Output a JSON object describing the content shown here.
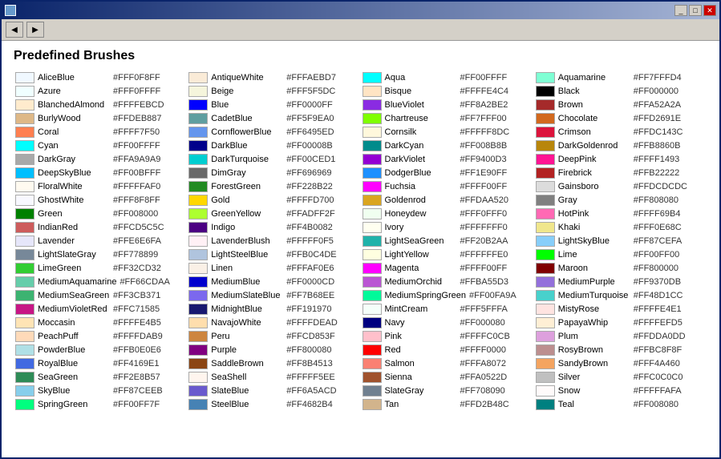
{
  "window": {
    "title": "",
    "toolbar": {
      "back_label": "◀",
      "forward_label": "▶"
    }
  },
  "page": {
    "title": "Predefined Brushes"
  },
  "colors": [
    {
      "name": "AliceBlue",
      "hex": "#FFF0F8FF",
      "swatch": "#F0F8FF"
    },
    {
      "name": "AntiqueWhite",
      "hex": "#FFFAEBD7",
      "swatch": "#FAEBD7"
    },
    {
      "name": "Aqua",
      "hex": "#FF00FFFF",
      "swatch": "#00FFFF"
    },
    {
      "name": "Aquamarine",
      "hex": "#FF7FFFD4",
      "swatch": "#7FFFD4"
    },
    {
      "name": "Azure",
      "hex": "#FFF0FFFF",
      "swatch": "#F0FFFF"
    },
    {
      "name": "Beige",
      "hex": "#FFF5F5DC",
      "swatch": "#F5F5DC"
    },
    {
      "name": "Bisque",
      "hex": "#FFFFE4C4",
      "swatch": "#FFE4C4"
    },
    {
      "name": "Black",
      "hex": "#FF000000",
      "swatch": "#000000"
    },
    {
      "name": "BlanchedAlmond",
      "hex": "#FFFFEBCD",
      "swatch": "#FFEBCD"
    },
    {
      "name": "Blue",
      "hex": "#FF0000FF",
      "swatch": "#0000FF"
    },
    {
      "name": "BlueViolet",
      "hex": "#FF8A2BE2",
      "swatch": "#8A2BE2"
    },
    {
      "name": "Brown",
      "hex": "#FFA52A2A",
      "swatch": "#A52A2A"
    },
    {
      "name": "BurlyWood",
      "hex": "#FFDEB887",
      "swatch": "#DEB887"
    },
    {
      "name": "CadetBlue",
      "hex": "#FF5F9EA0",
      "swatch": "#5F9EA0"
    },
    {
      "name": "Chartreuse",
      "hex": "#FF7FFF00",
      "swatch": "#7FFF00"
    },
    {
      "name": "Chocolate",
      "hex": "#FFD2691E",
      "swatch": "#D2691E"
    },
    {
      "name": "Coral",
      "hex": "#FFFF7F50",
      "swatch": "#FF7F50"
    },
    {
      "name": "CornflowerBlue",
      "hex": "#FF6495ED",
      "swatch": "#6495ED"
    },
    {
      "name": "Cornsilk",
      "hex": "#FFFFF8DC",
      "swatch": "#FFF8DC"
    },
    {
      "name": "Crimson",
      "hex": "#FFDC143C",
      "swatch": "#DC143C"
    },
    {
      "name": "Cyan",
      "hex": "#FF00FFFF",
      "swatch": "#00FFFF"
    },
    {
      "name": "DarkBlue",
      "hex": "#FF00008B",
      "swatch": "#00008B"
    },
    {
      "name": "DarkCyan",
      "hex": "#FF008B8B",
      "swatch": "#008B8B"
    },
    {
      "name": "DarkGoldenrod",
      "hex": "#FFB8860B",
      "swatch": "#B8860B"
    },
    {
      "name": "DarkGray",
      "hex": "#FFA9A9A9",
      "swatch": "#A9A9A9"
    },
    {
      "name": "DarkTurquoise",
      "hex": "#FF00CED1",
      "swatch": "#00CED1"
    },
    {
      "name": "DarkViolet",
      "hex": "#FF9400D3",
      "swatch": "#9400D3"
    },
    {
      "name": "DeepPink",
      "hex": "#FFFF1493",
      "swatch": "#FF1493"
    },
    {
      "name": "DeepSkyBlue",
      "hex": "#FF00BFFF",
      "swatch": "#00BFFF"
    },
    {
      "name": "DimGray",
      "hex": "#FF696969",
      "swatch": "#696969"
    },
    {
      "name": "DodgerBlue",
      "hex": "#FF1E90FF",
      "swatch": "#1E90FF"
    },
    {
      "name": "Firebrick",
      "hex": "#FFB22222",
      "swatch": "#B22222"
    },
    {
      "name": "FloralWhite",
      "hex": "#FFFFFAF0",
      "swatch": "#FFFAF0"
    },
    {
      "name": "ForestGreen",
      "hex": "#FF228B22",
      "swatch": "#228B22"
    },
    {
      "name": "Fuchsia",
      "hex": "#FFFF00FF",
      "swatch": "#FF00FF"
    },
    {
      "name": "Gainsboro",
      "hex": "#FFDCDCDC",
      "swatch": "#DCDCDC"
    },
    {
      "name": "GhostWhite",
      "hex": "#FFF8F8FF",
      "swatch": "#F8F8FF"
    },
    {
      "name": "Gold",
      "hex": "#FFFFD700",
      "swatch": "#FFD700"
    },
    {
      "name": "Goldenrod",
      "hex": "#FFDAA520",
      "swatch": "#DAA520"
    },
    {
      "name": "Gray",
      "hex": "#FF808080",
      "swatch": "#808080"
    },
    {
      "name": "Green",
      "hex": "#FF008000",
      "swatch": "#008000"
    },
    {
      "name": "GreenYellow",
      "hex": "#FFADFF2F",
      "swatch": "#ADFF2F"
    },
    {
      "name": "Honeydew",
      "hex": "#FFF0FFF0",
      "swatch": "#F0FFF0"
    },
    {
      "name": "HotPink",
      "hex": "#FFFF69B4",
      "swatch": "#FF69B4"
    },
    {
      "name": "IndianRed",
      "hex": "#FFCD5C5C",
      "swatch": "#CD5C5C"
    },
    {
      "name": "Indigo",
      "hex": "#FF4B0082",
      "swatch": "#4B0082"
    },
    {
      "name": "Ivory",
      "hex": "#FFFFFFF0",
      "swatch": "#FFFFF0"
    },
    {
      "name": "Khaki",
      "hex": "#FFF0E68C",
      "swatch": "#F0E68C"
    },
    {
      "name": "Lavender",
      "hex": "#FFE6E6FA",
      "swatch": "#E6E6FA"
    },
    {
      "name": "LavenderBlush",
      "hex": "#FFFFF0F5",
      "swatch": "#FFF0F5"
    },
    {
      "name": "LightSeaGreen",
      "hex": "#FF20B2AA",
      "swatch": "#20B2AA"
    },
    {
      "name": "LightSkyBlue",
      "hex": "#FF87CEFA",
      "swatch": "#87CEFA"
    },
    {
      "name": "LightSlateGray",
      "hex": "#FF778899",
      "swatch": "#778899"
    },
    {
      "name": "LightSteelBlue",
      "hex": "#FFB0C4DE",
      "swatch": "#B0C4DE"
    },
    {
      "name": "LightYellow",
      "hex": "#FFFFFFE0",
      "swatch": "#FFFFE0"
    },
    {
      "name": "Lime",
      "hex": "#FF00FF00",
      "swatch": "#00FF00"
    },
    {
      "name": "LimeGreen",
      "hex": "#FF32CD32",
      "swatch": "#32CD32"
    },
    {
      "name": "Linen",
      "hex": "#FFFAF0E6",
      "swatch": "#FAF0E6"
    },
    {
      "name": "Magenta",
      "hex": "#FFFF00FF",
      "swatch": "#FF00FF"
    },
    {
      "name": "Maroon",
      "hex": "#FF800000",
      "swatch": "#800000"
    },
    {
      "name": "MediumAquamarine",
      "hex": "#FF66CDAA",
      "swatch": "#66CDAA"
    },
    {
      "name": "MediumBlue",
      "hex": "#FF0000CD",
      "swatch": "#0000CD"
    },
    {
      "name": "MediumOrchid",
      "hex": "#FFBA55D3",
      "swatch": "#BA55D3"
    },
    {
      "name": "MediumPurple",
      "hex": "#FF9370DB",
      "swatch": "#9370DB"
    },
    {
      "name": "MediumSeaGreen",
      "hex": "#FF3CB371",
      "swatch": "#3CB371"
    },
    {
      "name": "MediumSlateBlue",
      "hex": "#FF7B68EE",
      "swatch": "#7B68EE"
    },
    {
      "name": "MediumSpringGreen",
      "hex": "#FF00FA9A",
      "swatch": "#00FA9A"
    },
    {
      "name": "MediumTurquoise",
      "hex": "#FF48D1CC",
      "swatch": "#48D1CC"
    },
    {
      "name": "MediumVioletRed",
      "hex": "#FFC71585",
      "swatch": "#C71585"
    },
    {
      "name": "MidnightBlue",
      "hex": "#FF191970",
      "swatch": "#191970"
    },
    {
      "name": "MintCream",
      "hex": "#FFF5FFFA",
      "swatch": "#F5FFFA"
    },
    {
      "name": "MistyRose",
      "hex": "#FFFFE4E1",
      "swatch": "#FFE4E1"
    },
    {
      "name": "Moccasin",
      "hex": "#FFFFE4B5",
      "swatch": "#FFE4B5"
    },
    {
      "name": "NavajoWhite",
      "hex": "#FFFFDEAD",
      "swatch": "#FFDEAD"
    },
    {
      "name": "Navy",
      "hex": "#FF000080",
      "swatch": "#000080"
    },
    {
      "name": "PapayaWhip",
      "hex": "#FFFFEFD5",
      "swatch": "#FFEFD5"
    },
    {
      "name": "PeachPuff",
      "hex": "#FFFFDAB9",
      "swatch": "#FFDAB9"
    },
    {
      "name": "Peru",
      "hex": "#FFCD853F",
      "swatch": "#CD853F"
    },
    {
      "name": "Pink",
      "hex": "#FFFFC0CB",
      "swatch": "#FFC0CB"
    },
    {
      "name": "Plum",
      "hex": "#FFDDA0DD",
      "swatch": "#DDA0DD"
    },
    {
      "name": "PowderBlue",
      "hex": "#FFB0E0E6",
      "swatch": "#B0E0E6"
    },
    {
      "name": "Purple",
      "hex": "#FF800080",
      "swatch": "#800080"
    },
    {
      "name": "Red",
      "hex": "#FFFF0000",
      "swatch": "#FF0000"
    },
    {
      "name": "RosyBrown",
      "hex": "#FFBC8F8F",
      "swatch": "#BC8F8F"
    },
    {
      "name": "RoyalBlue",
      "hex": "#FF4169E1",
      "swatch": "#4169E1"
    },
    {
      "name": "SaddleBrown",
      "hex": "#FF8B4513",
      "swatch": "#8B4513"
    },
    {
      "name": "Salmon",
      "hex": "#FFFA8072",
      "swatch": "#FA8072"
    },
    {
      "name": "SandyBrown",
      "hex": "#FFF4A460",
      "swatch": "#F4A460"
    },
    {
      "name": "SeaGreen",
      "hex": "#FF2E8B57",
      "swatch": "#2E8B57"
    },
    {
      "name": "SeaShell",
      "hex": "#FFFFF5EE",
      "swatch": "#FFF5EE"
    },
    {
      "name": "Sienna",
      "hex": "#FFA0522D",
      "swatch": "#A0522D"
    },
    {
      "name": "Silver",
      "hex": "#FFC0C0C0",
      "swatch": "#C0C0C0"
    },
    {
      "name": "SkyBlue",
      "hex": "#FF87CEEB",
      "swatch": "#87CEEB"
    },
    {
      "name": "SlateBlue",
      "hex": "#FF6A5ACD",
      "swatch": "#6A5ACD"
    },
    {
      "name": "SlateGray",
      "hex": "#FF708090",
      "swatch": "#708090"
    },
    {
      "name": "Snow",
      "hex": "#FFFFFAFA",
      "swatch": "#FFFAFA"
    },
    {
      "name": "SpringGreen",
      "hex": "#FF00FF7F",
      "swatch": "#00FF7F"
    },
    {
      "name": "SteelBlue",
      "hex": "#FF4682B4",
      "swatch": "#4682B4"
    },
    {
      "name": "Tan",
      "hex": "#FFD2B48C",
      "swatch": "#D2B48C"
    },
    {
      "name": "Teal",
      "hex": "#FF008080",
      "swatch": "#008080"
    }
  ]
}
